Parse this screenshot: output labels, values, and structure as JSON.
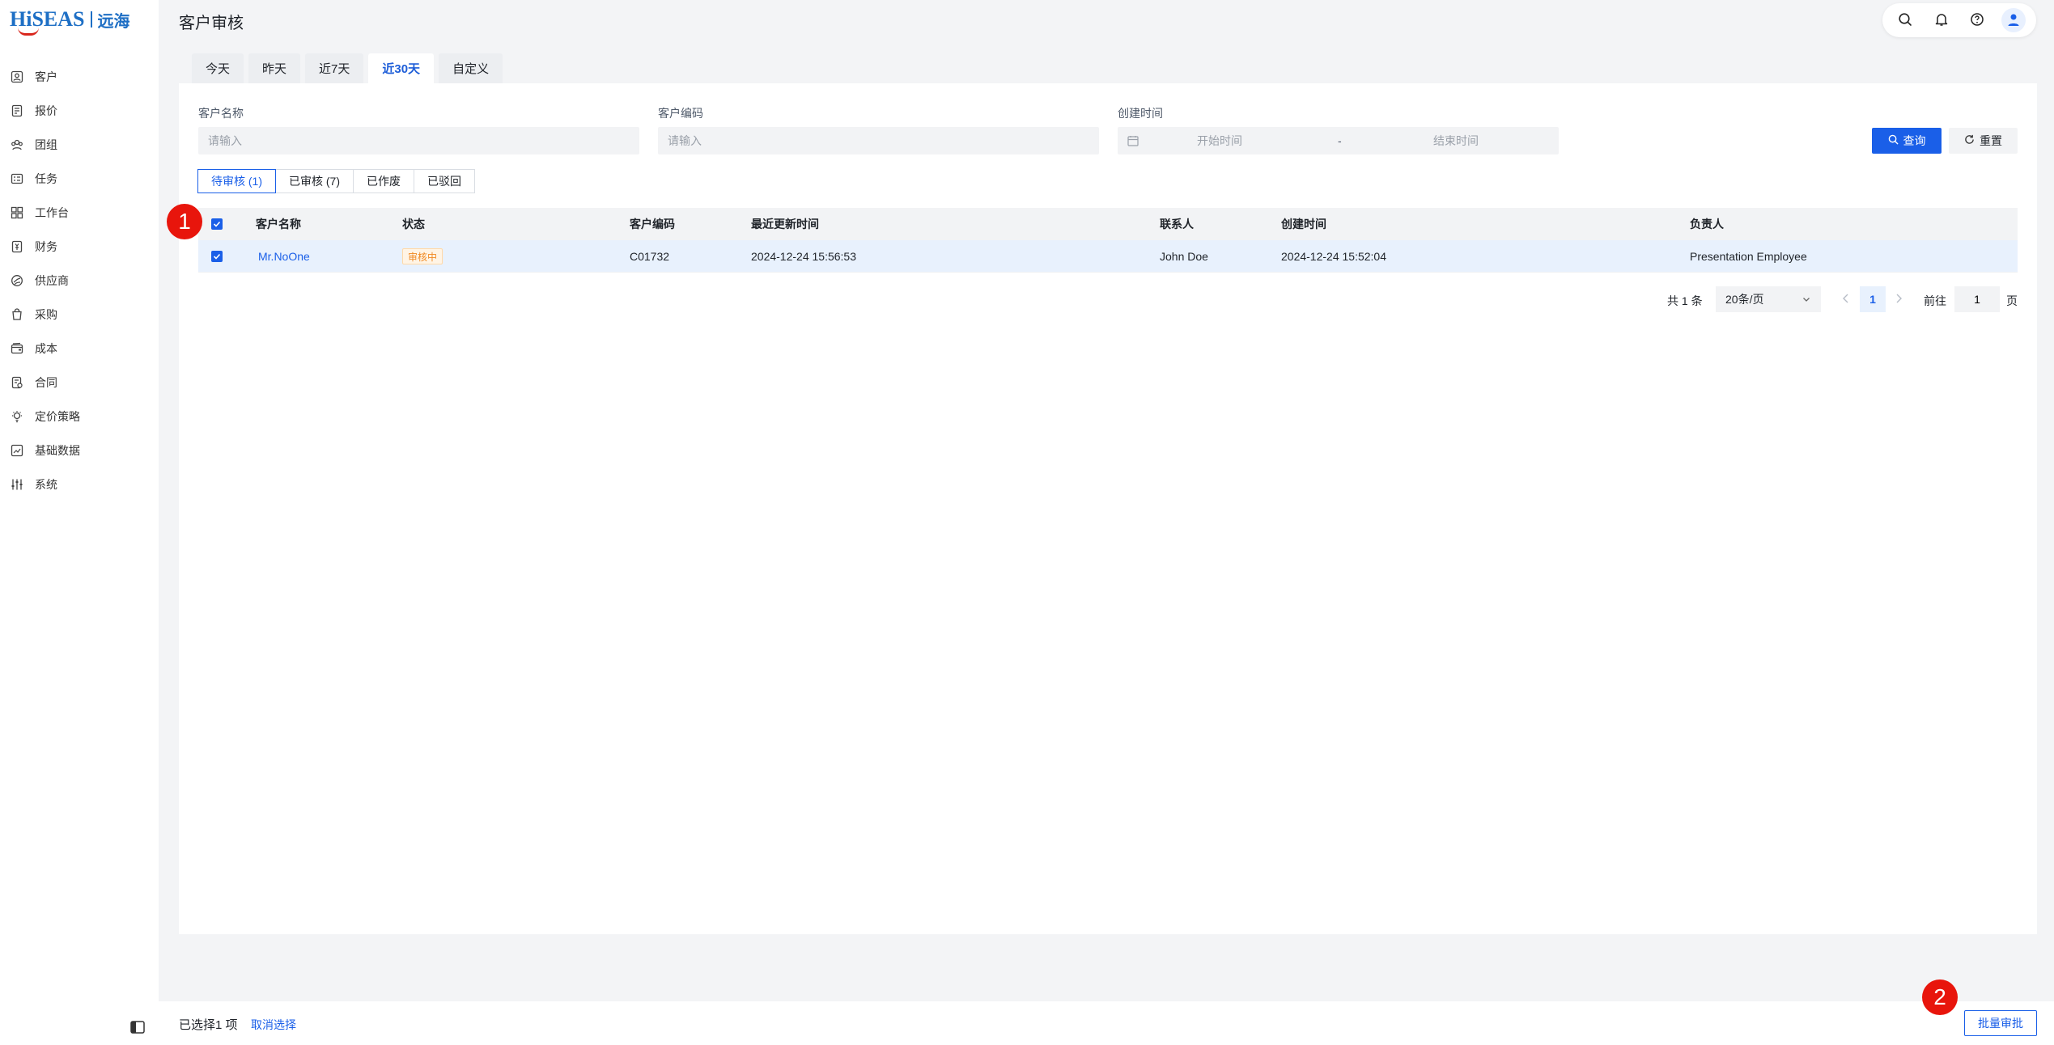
{
  "logo": {
    "brand": "HiSEAS",
    "cn": "远海"
  },
  "sidebar": {
    "items": [
      {
        "label": "客户",
        "icon": "customer-icon"
      },
      {
        "label": "报价",
        "icon": "quote-icon"
      },
      {
        "label": "团组",
        "icon": "group-icon"
      },
      {
        "label": "任务",
        "icon": "task-icon"
      },
      {
        "label": "工作台",
        "icon": "workbench-icon"
      },
      {
        "label": "财务",
        "icon": "finance-icon"
      },
      {
        "label": "供应商",
        "icon": "supplier-icon"
      },
      {
        "label": "采购",
        "icon": "purchase-icon"
      },
      {
        "label": "成本",
        "icon": "cost-icon"
      },
      {
        "label": "合同",
        "icon": "contract-icon"
      },
      {
        "label": "定价策略",
        "icon": "pricing-icon"
      },
      {
        "label": "基础数据",
        "icon": "basic-data-icon"
      },
      {
        "label": "系统",
        "icon": "system-icon"
      }
    ]
  },
  "header": {
    "title": "客户审核"
  },
  "date_tabs": [
    {
      "label": "今天"
    },
    {
      "label": "昨天"
    },
    {
      "label": "近7天"
    },
    {
      "label": "近30天",
      "active": true
    },
    {
      "label": "自定义"
    }
  ],
  "filters": {
    "name_label": "客户名称",
    "name_placeholder": "请输入",
    "code_label": "客户编码",
    "code_placeholder": "请输入",
    "created_label": "创建时间",
    "start_placeholder": "开始时间",
    "range_sep": "-",
    "end_placeholder": "结束时间",
    "search_label": "查询",
    "reset_label": "重置"
  },
  "status_tabs": [
    {
      "label": "待审核 (1)",
      "active": true
    },
    {
      "label": "已审核 (7)"
    },
    {
      "label": "已作废"
    },
    {
      "label": "已驳回"
    }
  ],
  "table": {
    "columns": [
      "客户名称",
      "状态",
      "客户编码",
      "最近更新时间",
      "联系人",
      "创建时间",
      "负责人"
    ],
    "rows": [
      {
        "name": "Mr.NoOne",
        "status": "审核中",
        "code": "C01732",
        "updated": "2024-12-24 15:56:53",
        "contact": "John Doe",
        "created": "2024-12-24 15:52:04",
        "owner": "Presentation Employee",
        "checked": true
      }
    ]
  },
  "pagination": {
    "total": "共 1 条",
    "page_size": "20条/页",
    "current_page": "1",
    "goto_label": "前往",
    "goto_value": "1",
    "page_unit": "页"
  },
  "footer": {
    "selected": "已选择1 项",
    "cancel": "取消选择",
    "batch": "批量审批"
  },
  "markers": [
    "1",
    "2"
  ],
  "colors": {
    "primary": "#1a5fe8",
    "badge_orange": "#f08a24",
    "marker_red": "#e8150c"
  }
}
